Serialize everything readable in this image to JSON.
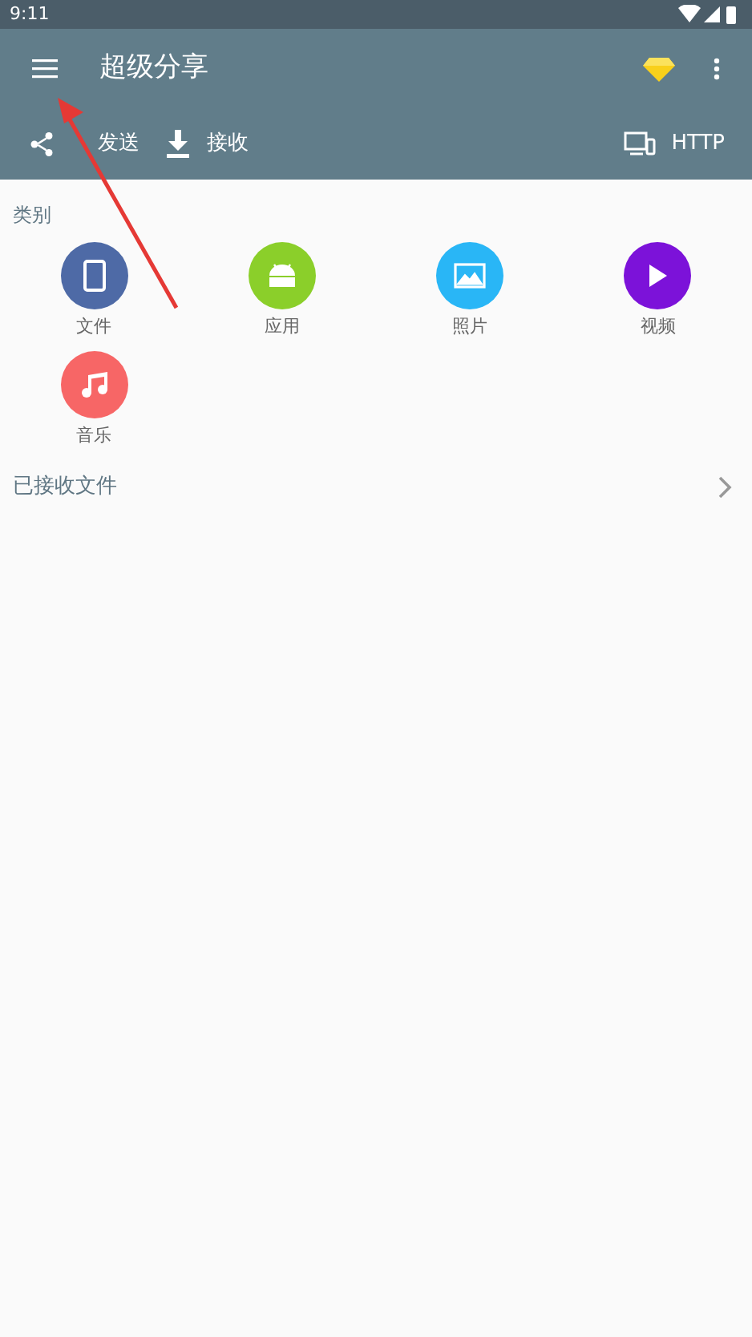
{
  "status_bar": {
    "time": "9:11"
  },
  "app_bar": {
    "title": "超级分享"
  },
  "actions": [
    {
      "kind": "share",
      "label": "发送"
    },
    {
      "kind": "download",
      "label": "接收"
    },
    {
      "kind": "devices",
      "label": "HTTP"
    }
  ],
  "categories_title": "类别",
  "categories": [
    {
      "kind": "phone",
      "label": "文件",
      "color": "#4e6aa6"
    },
    {
      "kind": "android",
      "label": "应用",
      "color": "#8bcf2a"
    },
    {
      "kind": "image",
      "label": "照片",
      "color": "#29b6f6"
    },
    {
      "kind": "play",
      "label": "视频",
      "color": "#7c12d9"
    },
    {
      "kind": "music",
      "label": "音乐",
      "color": "#f76666"
    }
  ],
  "received": {
    "label": "已接收文件"
  }
}
